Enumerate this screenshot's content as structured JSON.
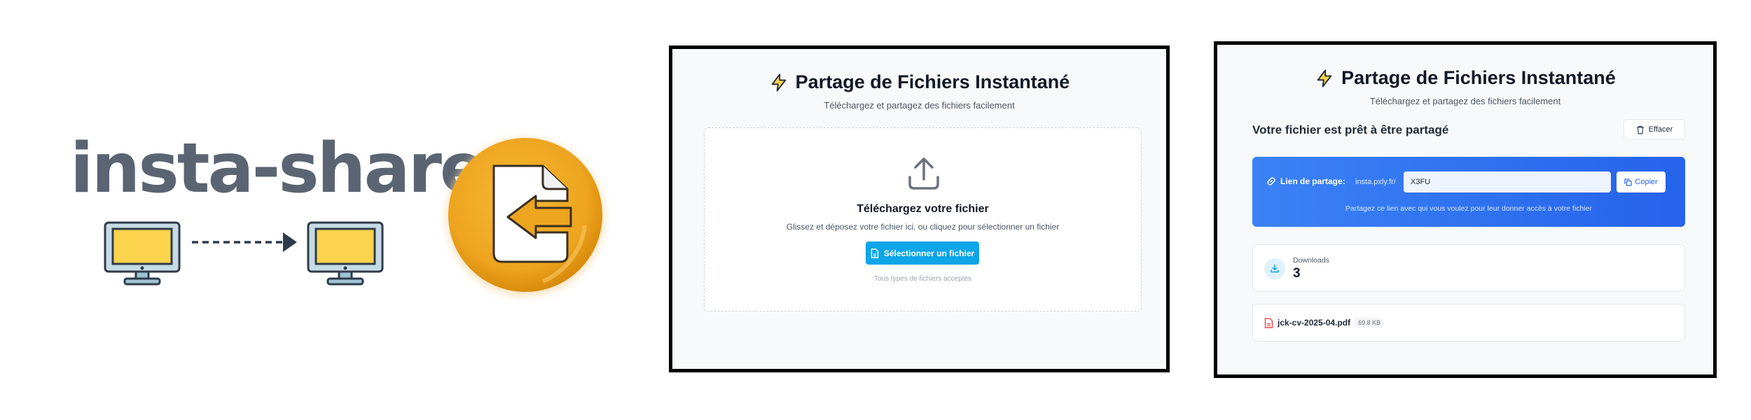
{
  "logo": {
    "wordmark": "insta-share",
    "colors": {
      "wordmark": "#5b6472",
      "screen": "#fcd34d",
      "monitor_frame": "#9fc3d4",
      "badge": "#eda41e"
    }
  },
  "panel_upload": {
    "header": {
      "icon": "lightning-icon",
      "title": "Partage de Fichiers Instantané",
      "subtitle": "Téléchargez et partagez des fichiers facilement"
    },
    "dropzone": {
      "icon": "upload-icon",
      "title": "Téléchargez votre fichier",
      "description": "Glissez et déposez votre fichier ici, ou cliquez pour sélectionner un fichier",
      "button_label": "Sélectionner un fichier",
      "hint": "Tous types de fichiers acceptés"
    }
  },
  "panel_shared": {
    "header": {
      "icon": "lightning-icon",
      "title": "Partage de Fichiers Instantané",
      "subtitle": "Téléchargez et partagez des fichiers facilement"
    },
    "ready_title": "Votre fichier est prêt à être partagé",
    "clear_label": "Effacer",
    "share": {
      "label": "Lien de partage:",
      "prefix": "insta.pxly.fr/",
      "code": "X3FU",
      "copy_label": "Copier",
      "note": "Partagez ce lien avec qui vous voulez pour leur donner accès à votre fichier"
    },
    "downloads": {
      "label": "Downloads",
      "count": "3"
    },
    "file": {
      "name": "jck-cv-2025-04.pdf",
      "size": "69.8 KB"
    }
  },
  "accent": {
    "primary_button": "#0ea5e9",
    "share_blue": "#2563eb",
    "lightning": "#f5b70a"
  }
}
